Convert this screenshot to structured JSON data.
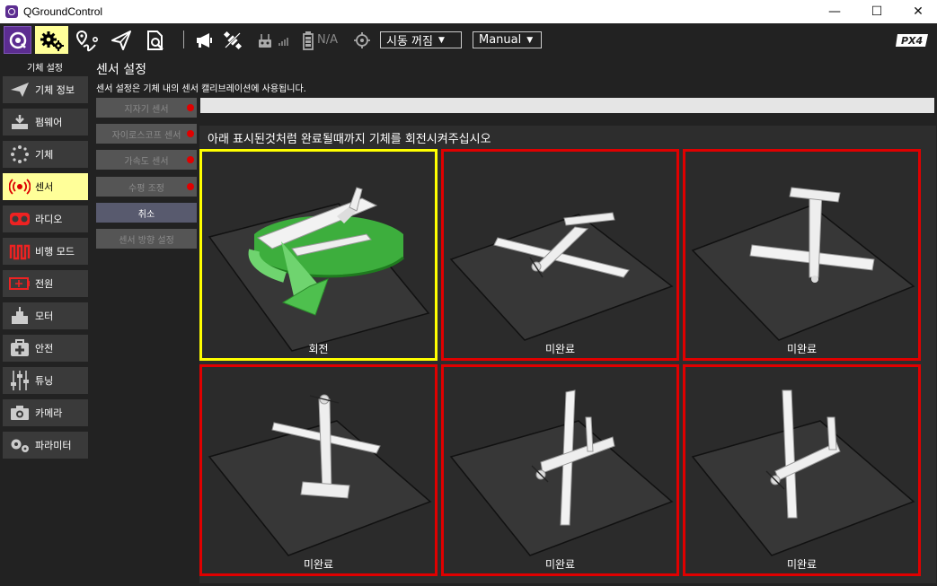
{
  "window": {
    "title": "QGroundControl",
    "minimize": "—",
    "maximize": "☐",
    "close": "✕"
  },
  "toolbar": {
    "battery_text": "N/A",
    "arm_dropdown": "시동 꺼짐",
    "mode_dropdown": "Manual",
    "brand": "PX4"
  },
  "sidebar": {
    "heading": "기체 설정",
    "items": [
      {
        "label": "기체 정보",
        "icon": "plane-icon"
      },
      {
        "label": "펌웨어",
        "icon": "firmware-icon"
      },
      {
        "label": "기체",
        "icon": "airframe-icon"
      },
      {
        "label": "센서",
        "icon": "sensor-icon",
        "active": true
      },
      {
        "label": "라디오",
        "icon": "radio-icon"
      },
      {
        "label": "비행 모드",
        "icon": "flight-mode-icon"
      },
      {
        "label": "전원",
        "icon": "battery-icon"
      },
      {
        "label": "모터",
        "icon": "motor-icon"
      },
      {
        "label": "안전",
        "icon": "safety-icon"
      },
      {
        "label": "튜닝",
        "icon": "tuning-icon"
      },
      {
        "label": "카메라",
        "icon": "camera-icon"
      },
      {
        "label": "파라미터",
        "icon": "parameters-icon"
      }
    ]
  },
  "page": {
    "title": "센서 설정",
    "description": "센서 설정은 기체 내의 센서 캘리브레이션에 사용됩니다.",
    "instruction": "아래 표시된것처럼 완료될때까지 기체를 회전시켜주십시오",
    "progress_fraction": 0.0
  },
  "sensor_buttons": [
    {
      "label": "지자기 센서",
      "dot": true
    },
    {
      "label": "자이로스코프 센서",
      "dot": true
    },
    {
      "label": "가속도 센서",
      "dot": true
    },
    {
      "label": "수평 조정",
      "dot": true
    },
    {
      "label": "취소",
      "dot": false
    },
    {
      "label": "센서 방향 설정",
      "dot": false
    }
  ],
  "orientations": [
    {
      "status": "회전",
      "state": "current"
    },
    {
      "status": "미완료",
      "state": "incomplete"
    },
    {
      "status": "미완료",
      "state": "incomplete"
    },
    {
      "status": "미완료",
      "state": "incomplete"
    },
    {
      "status": "미완료",
      "state": "incomplete"
    },
    {
      "status": "미완료",
      "state": "incomplete"
    }
  ],
  "colors": {
    "accent_active": "#ffff99",
    "current_border": "#ffff00",
    "incomplete_border": "#e00000",
    "progress_track": "#e5e5e5"
  }
}
